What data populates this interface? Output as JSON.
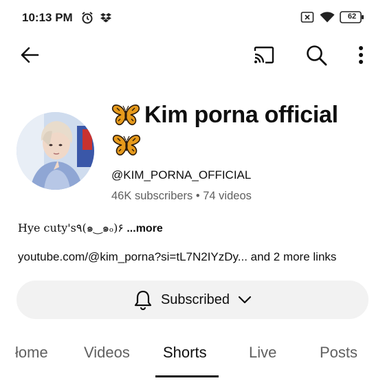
{
  "status_bar": {
    "time": "10:13 PM",
    "battery": "62",
    "icons": [
      "alarm-icon",
      "dropbox-icon",
      "sim-off-icon",
      "wifi-icon",
      "battery-icon"
    ]
  },
  "topbar": {
    "icons": [
      "back-arrow-icon",
      "cast-icon",
      "search-icon",
      "more-vert-icon"
    ]
  },
  "channel": {
    "name": "Kim porna official",
    "handle": "@KIM_PORNA_OFFICIAL",
    "stats": "46K subscribers • 74 videos",
    "description": "Hye cuty's٩(๑‿๑ₒ)۶",
    "description_more": " ...more",
    "links": "youtube.com/@kim_porna?si=tL7N2IYzDy... and 2 more links"
  },
  "subscribe": {
    "label": "Subscribed"
  },
  "tabs": [
    {
      "label": "Home",
      "visible_text": "łome"
    },
    {
      "label": "Videos"
    },
    {
      "label": "Shorts",
      "active": true
    },
    {
      "label": "Live"
    },
    {
      "label": "Posts"
    }
  ],
  "colors": {
    "accent_text": "#0f0f0f",
    "secondary_text": "#606060",
    "subscribe_bg": "#f2f2f2",
    "butterfly": "#e69a1c"
  }
}
